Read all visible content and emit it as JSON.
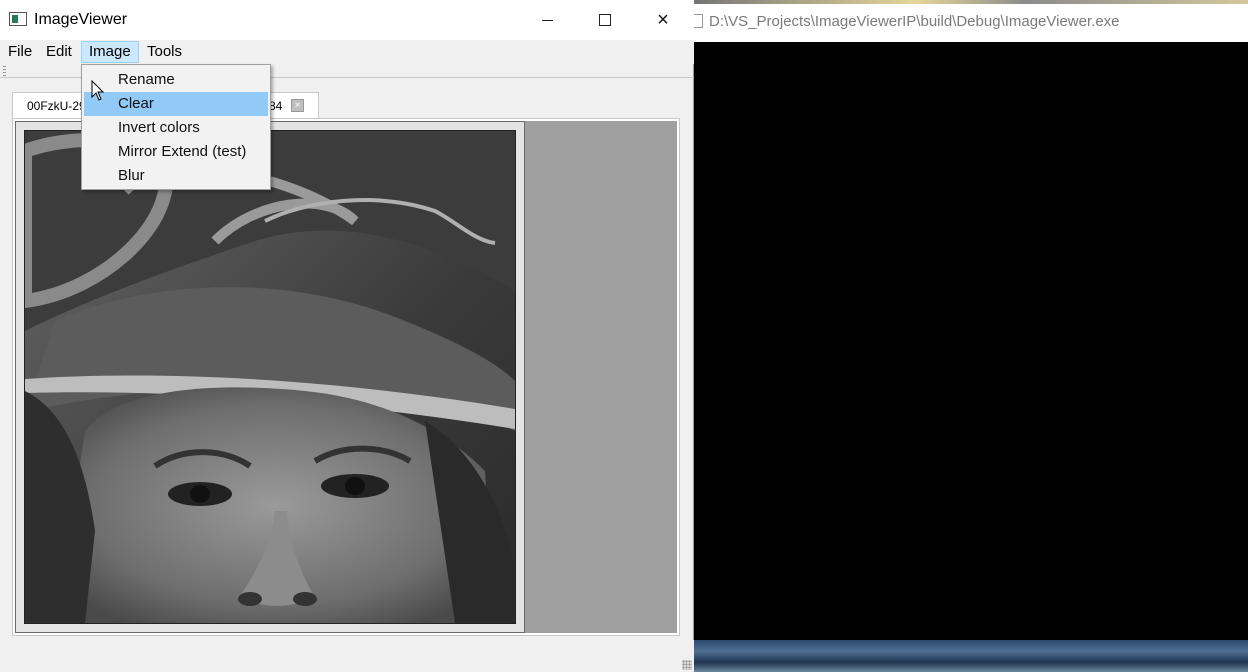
{
  "window": {
    "title": "ImageViewer",
    "controls": {
      "minimize": "minimize",
      "maximize": "maximize",
      "close": "×"
    }
  },
  "menubar": {
    "items": [
      "File",
      "Edit",
      "Image",
      "Tools"
    ],
    "active": "Image"
  },
  "dropdown": {
    "items": [
      "Rename",
      "Clear",
      "Invert colors",
      "Mirror Extend (test)",
      "Blur"
    ],
    "highlighted": "Clear"
  },
  "tab": {
    "label_visible_start": "00FzkU-29",
    "label_visible_end": "84",
    "close": "×"
  },
  "console": {
    "title": "D:\\VS_Projects\\ImageViewerIP\\build\\Debug\\ImageViewer.exe"
  },
  "colors": {
    "menu_highlight": "#91c9f7",
    "menu_active": "#cce8ff",
    "canvas": "#a0a0a0"
  },
  "icons": [
    "app-icon",
    "minimize-icon",
    "maximize-icon",
    "close-icon",
    "mouse-cursor-icon",
    "tab-close-icon",
    "size-grip-icon"
  ]
}
